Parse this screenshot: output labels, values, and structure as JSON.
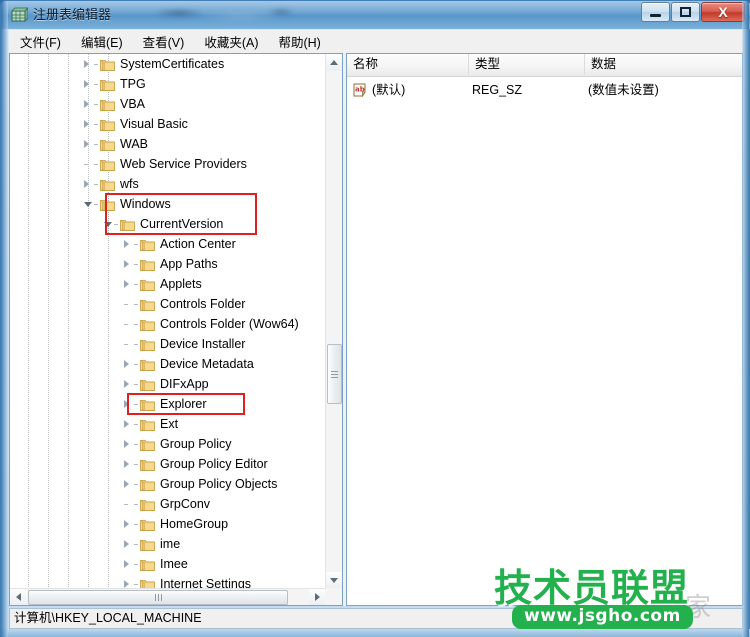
{
  "window": {
    "title": "注册表编辑器",
    "app_icon": "registry-editor-icon",
    "buttons": {
      "minimize": "─",
      "maximize": "□",
      "close": "X"
    }
  },
  "menu": {
    "items": [
      {
        "label": "文件(F)",
        "name": "menu-file"
      },
      {
        "label": "编辑(E)",
        "name": "menu-edit"
      },
      {
        "label": "查看(V)",
        "name": "menu-view"
      },
      {
        "label": "收藏夹(A)",
        "name": "menu-favorites"
      },
      {
        "label": "帮助(H)",
        "name": "menu-help"
      }
    ]
  },
  "tree": {
    "nodes": [
      {
        "label": "SystemCertificates",
        "depth": 3,
        "state": "collapsed",
        "highlight": "none"
      },
      {
        "label": "TPG",
        "depth": 3,
        "state": "collapsed",
        "highlight": "none"
      },
      {
        "label": "VBA",
        "depth": 3,
        "state": "collapsed",
        "highlight": "none"
      },
      {
        "label": "Visual Basic",
        "depth": 3,
        "state": "collapsed",
        "highlight": "none"
      },
      {
        "label": "WAB",
        "depth": 3,
        "state": "collapsed",
        "highlight": "none"
      },
      {
        "label": "Web Service Providers",
        "depth": 3,
        "state": "leaf",
        "highlight": "none"
      },
      {
        "label": "wfs",
        "depth": 3,
        "state": "collapsed",
        "highlight": "none"
      },
      {
        "label": "Windows",
        "depth": 3,
        "state": "expanded",
        "highlight": "box1"
      },
      {
        "label": "CurrentVersion",
        "depth": 4,
        "state": "expanded",
        "highlight": "box1"
      },
      {
        "label": "Action Center",
        "depth": 5,
        "state": "collapsed",
        "highlight": "none"
      },
      {
        "label": "App Paths",
        "depth": 5,
        "state": "collapsed",
        "highlight": "none"
      },
      {
        "label": "Applets",
        "depth": 5,
        "state": "collapsed",
        "highlight": "none"
      },
      {
        "label": "Controls Folder",
        "depth": 5,
        "state": "leaf",
        "highlight": "none"
      },
      {
        "label": "Controls Folder (Wow64)",
        "depth": 5,
        "state": "leaf",
        "highlight": "none"
      },
      {
        "label": "Device Installer",
        "depth": 5,
        "state": "leaf",
        "highlight": "none"
      },
      {
        "label": "Device Metadata",
        "depth": 5,
        "state": "collapsed",
        "highlight": "none"
      },
      {
        "label": "DIFxApp",
        "depth": 5,
        "state": "collapsed",
        "highlight": "none"
      },
      {
        "label": "Explorer",
        "depth": 5,
        "state": "collapsed",
        "highlight": "box2"
      },
      {
        "label": "Ext",
        "depth": 5,
        "state": "collapsed",
        "highlight": "none"
      },
      {
        "label": "Group Policy",
        "depth": 5,
        "state": "collapsed",
        "highlight": "none"
      },
      {
        "label": "Group Policy Editor",
        "depth": 5,
        "state": "collapsed",
        "highlight": "none"
      },
      {
        "label": "Group Policy Objects",
        "depth": 5,
        "state": "collapsed",
        "highlight": "none"
      },
      {
        "label": "GrpConv",
        "depth": 5,
        "state": "leaf",
        "highlight": "none"
      },
      {
        "label": "HomeGroup",
        "depth": 5,
        "state": "collapsed",
        "highlight": "none"
      },
      {
        "label": "ime",
        "depth": 5,
        "state": "collapsed",
        "highlight": "none"
      },
      {
        "label": "Imee",
        "depth": 5,
        "state": "collapsed",
        "highlight": "none"
      },
      {
        "label": "Internet Settings",
        "depth": 5,
        "state": "collapsed",
        "highlight": "none"
      }
    ],
    "highlight_color": "#e02020"
  },
  "list": {
    "columns": [
      {
        "label": "名称",
        "name": "column-name"
      },
      {
        "label": "类型",
        "name": "column-type"
      },
      {
        "label": "数据",
        "name": "column-data"
      }
    ],
    "rows": [
      {
        "icon": "string-value-icon",
        "name": "(默认)",
        "type": "REG_SZ",
        "data": "(数值未设置)"
      }
    ]
  },
  "statusbar": {
    "path": "计算机\\HKEY_LOCAL_MACHINE"
  },
  "watermark": {
    "title": "技术员联盟",
    "ghost": "之家",
    "url": "www.jsgho.com",
    "color": "#22b14c"
  }
}
